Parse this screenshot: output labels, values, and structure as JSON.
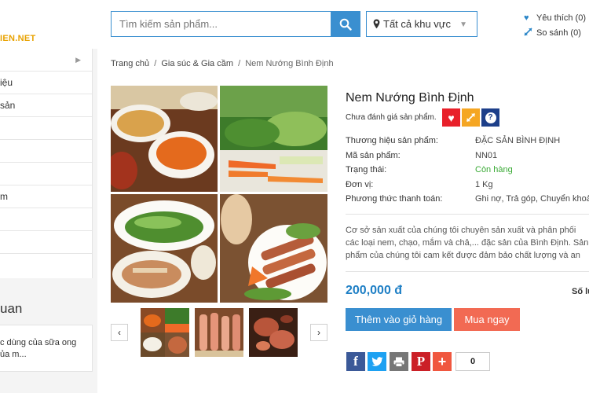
{
  "header": {
    "logo_text": "IEN.NET",
    "search_placeholder": "Tìm kiếm sản phẩm...",
    "region_label": "Tất cả khu vực",
    "wishlist_label": "Yêu thích (0)",
    "compare_label": "So sánh (0)"
  },
  "sidebar": {
    "items": [
      {
        "label": ""
      },
      {
        "label": "iệu"
      },
      {
        "label": " sản"
      },
      {
        "label": ""
      },
      {
        "label": ""
      },
      {
        "label": ""
      },
      {
        "label": "m"
      },
      {
        "label": ""
      },
      {
        "label": ""
      }
    ],
    "section_title": "uan",
    "news_snippet": "c dùng của sữa ong\nủa m..."
  },
  "breadcrumb": {
    "home": "Trang chủ",
    "category": "Gia súc & Gia cầm",
    "current": "Nem Nướng Bình Định",
    "separator": "/"
  },
  "product": {
    "title": "Nem Nướng Bình Định",
    "rating_text": "Chưa đánh giá sản phẩm.",
    "specs": [
      {
        "label": "Thương hiệu sản phẩm:",
        "value": "ĐẶC SẢN BÌNH ĐỊNH"
      },
      {
        "label": "Mã sản phẩm:",
        "value": "NN01"
      },
      {
        "label": "Trạng thái:",
        "value": "Còn hàng"
      },
      {
        "label": "Đơn vị:",
        "value": "1 Kg"
      },
      {
        "label": "Phương thức thanh toán:",
        "value": "Ghi nợ, Trả góp, Chuyển khoản,"
      }
    ],
    "description": "Cơ sở sản xuất của chúng tôi chuyên sản xuất và phân phối các loại nem, chạo, mắm và chả,... đặc sản của Bình Định. Sản phẩm của chúng tôi cam kết được đảm bảo chất lượng và an toàn vệ sinh thực phẩm.",
    "price": "200,000 đ",
    "qty_label": "Số lượng",
    "add_to_cart": "Thêm vào giỏ hàng",
    "buy_now": "Mua ngay",
    "share_count": "0",
    "thumb_prev": "‹",
    "thumb_next": "›"
  },
  "colors": {
    "accent": "#3a8fd0",
    "price": "#1e7fc5",
    "buy": "#f26a53",
    "in_stock": "#3aaa35",
    "wishlist_btn": "#e8202a",
    "compare_btn": "#f5a623",
    "help_btn": "#1d3f8a"
  },
  "icons": {
    "search": "search-icon",
    "region": "map-pin-icon",
    "wishlist": "heart-icon",
    "compare": "compare-arrows-icon",
    "help": "question-icon"
  }
}
